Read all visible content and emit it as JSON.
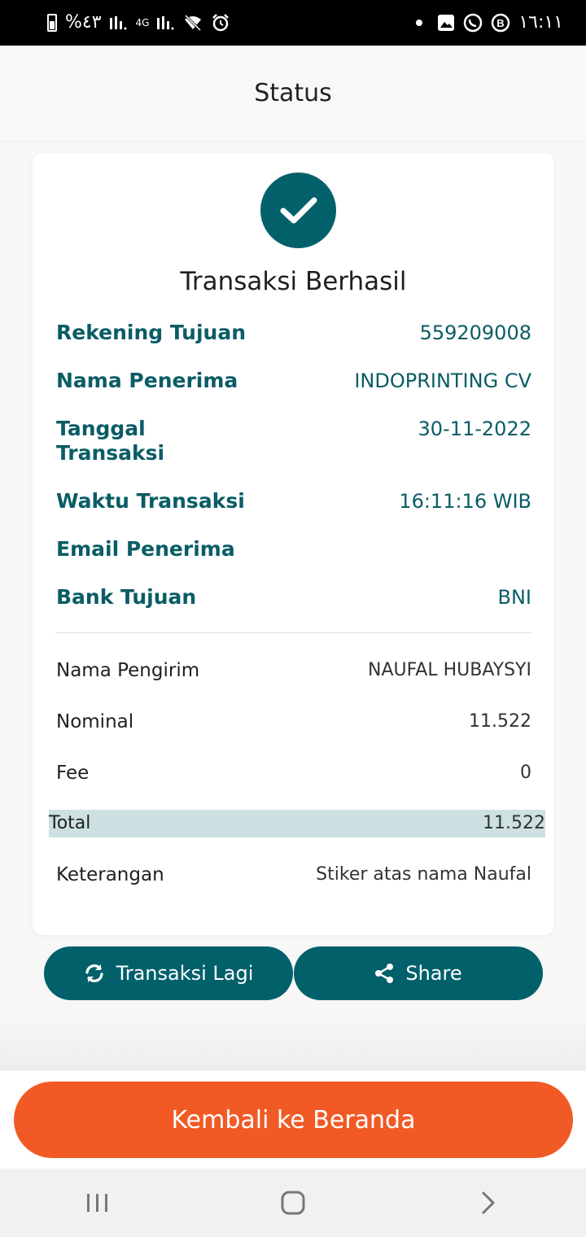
{
  "status_bar": {
    "left_text": "%٤٣",
    "network": "4G",
    "time": "١٦:١١"
  },
  "header": {
    "title": "Status"
  },
  "result": {
    "title": "Transaksi Berhasil"
  },
  "details": [
    {
      "label": "Rekening Tujuan",
      "value": "559209008"
    },
    {
      "label": "Nama Penerima",
      "value": "INDOPRINTING CV"
    },
    {
      "label": "Tanggal Transaksi",
      "value": "30-11-2022"
    },
    {
      "label": "Waktu Transaksi",
      "value": "16:11:16 WIB"
    },
    {
      "label": "Email Penerima",
      "value": ""
    },
    {
      "label": "Bank Tujuan",
      "value": "BNI"
    }
  ],
  "summary": [
    {
      "label": "Nama Pengirim",
      "value": "NAUFAL HUBAYSYI"
    },
    {
      "label": "Nominal",
      "value": "11.522"
    },
    {
      "label": "Fee",
      "value": "0"
    }
  ],
  "total": {
    "label": "Total",
    "value": "11.522"
  },
  "note": {
    "label": "Keterangan",
    "value": "Stiker atas nama Naufal"
  },
  "actions": {
    "repeat_label": "Transaksi Lagi",
    "share_label": "Share",
    "home_label": "Kembali ke Beranda"
  },
  "icons": {
    "check": "check-icon",
    "repeat": "refresh-icon",
    "share": "share-icon"
  },
  "colors": {
    "teal": "#02606b",
    "orange": "#f15a24",
    "total_highlight": "#cde1e2"
  }
}
